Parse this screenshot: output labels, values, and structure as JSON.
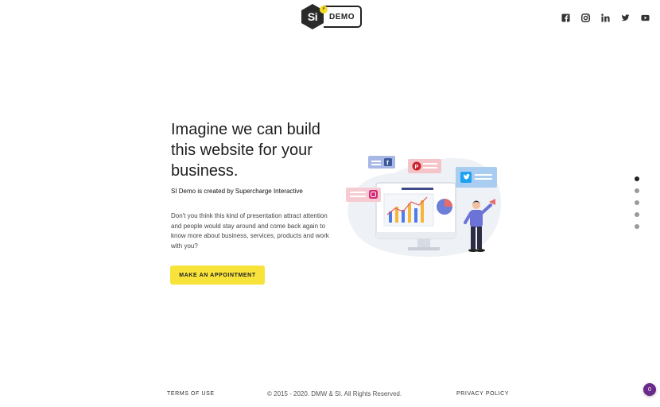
{
  "header": {
    "logo": {
      "mark": "Si",
      "label": "DEMO"
    },
    "social": [
      {
        "name": "facebook-icon"
      },
      {
        "name": "instagram-icon"
      },
      {
        "name": "linkedin-icon"
      },
      {
        "name": "twitter-icon"
      },
      {
        "name": "youtube-icon"
      }
    ]
  },
  "hero": {
    "title_line1": "Imagine we can build",
    "title_line2": "this website for your",
    "title_line3": "business.",
    "subtitle": "SI Demo is created by Supercharge Interactive",
    "body": "Don't you think this kind of presentation attract attention and people would stay around and come back again to know more about business, services, products and work with you?",
    "cta_label": "MAKE AN APPOINTMENT"
  },
  "pagination": {
    "count": 5,
    "active_index": 0
  },
  "footer": {
    "terms": "TERMS OF USE",
    "copyright": "© 2015 - 2020. DMW & SI. All Rights Reserved.",
    "privacy": "PRIVACY POLICY",
    "chat_badge": "0"
  },
  "colors": {
    "accent": "#f7e33a",
    "dark": "#222222",
    "chat": "#6a2a8a"
  }
}
